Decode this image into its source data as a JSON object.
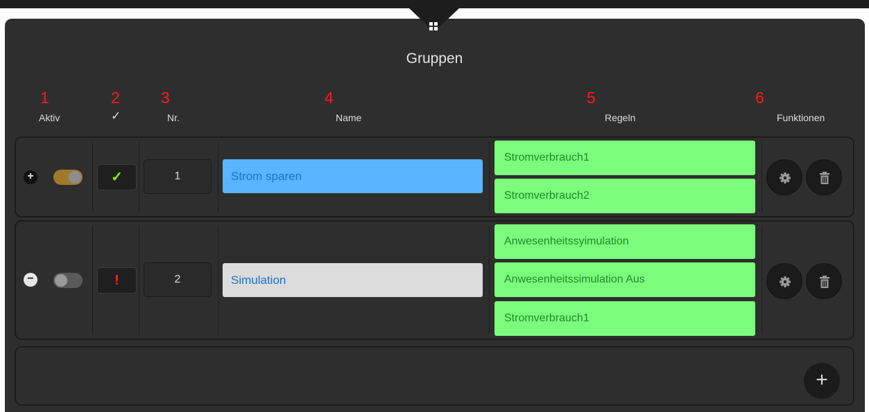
{
  "title": "Gruppen",
  "column_numbers": [
    "1",
    "2",
    "3",
    "4",
    "5",
    "6"
  ],
  "columns": {
    "active": "Aktiv",
    "status": "✓",
    "nr": "Nr.",
    "name": "Name",
    "rules": "Regeln",
    "functions": "Funktionen"
  },
  "groups": [
    {
      "expand_symbol": "+",
      "active": true,
      "status_symbol": "✓",
      "status_color": "#7cfc00",
      "nr": "1",
      "name": "Strom sparen",
      "name_bg": "#5ab4ff",
      "rules": [
        "Stromverbrauch1",
        "Stromverbrauch2"
      ]
    },
    {
      "expand_symbol": "−",
      "active": false,
      "status_symbol": "!",
      "status_color": "#ff2222",
      "nr": "2",
      "name": "Simulation",
      "name_bg": "#dcdcdc",
      "rules": [
        "Anwesenheitssyimulation",
        "Anwesenheitssimulation Aus",
        "Stromverbrauch1"
      ]
    }
  ],
  "add_label": "+",
  "icons": {
    "header": "grid-icon",
    "settings": "gear-icon",
    "delete": "trash-icon",
    "add": "plus-icon"
  },
  "colors": {
    "panel_bg": "#2e2e2e",
    "toggle_on": "#a07a2a",
    "toggle_off": "#5a5a5a",
    "rule_bg": "#7cfc7c",
    "rule_text": "#1f8a2a",
    "annotation": "#ff1a1a"
  }
}
